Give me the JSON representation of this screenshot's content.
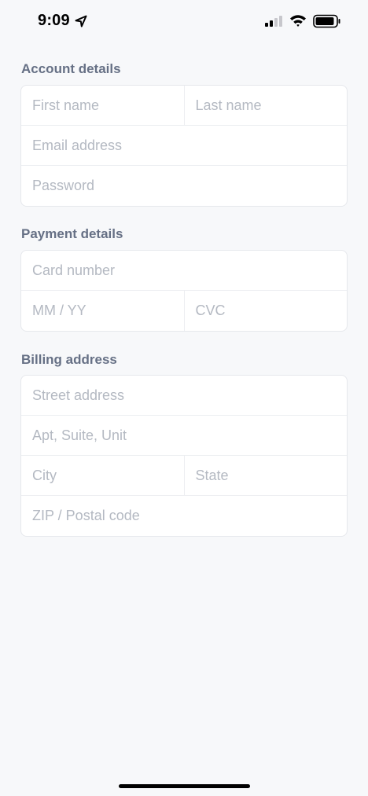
{
  "status_bar": {
    "time": "9:09",
    "icons": [
      "location-arrow-icon",
      "cellular-signal-icon",
      "wifi-icon",
      "battery-icon"
    ]
  },
  "account": {
    "title": "Account details",
    "first_name_placeholder": "First name",
    "last_name_placeholder": "Last name",
    "email_placeholder": "Email address",
    "password_placeholder": "Password"
  },
  "payment": {
    "title": "Payment details",
    "card_number_placeholder": "Card number",
    "expiry_placeholder": "MM / YY",
    "cvc_placeholder": "CVC"
  },
  "billing": {
    "title": "Billing address",
    "street_placeholder": "Street address",
    "apt_placeholder": "Apt, Suite, Unit",
    "city_placeholder": "City",
    "state_placeholder": "State",
    "zip_placeholder": "ZIP / Postal code"
  },
  "colors": {
    "background": "#f7f8fa",
    "section_title": "#667085",
    "placeholder": "#b4b9c2",
    "card_border": "#e6e8ec"
  }
}
